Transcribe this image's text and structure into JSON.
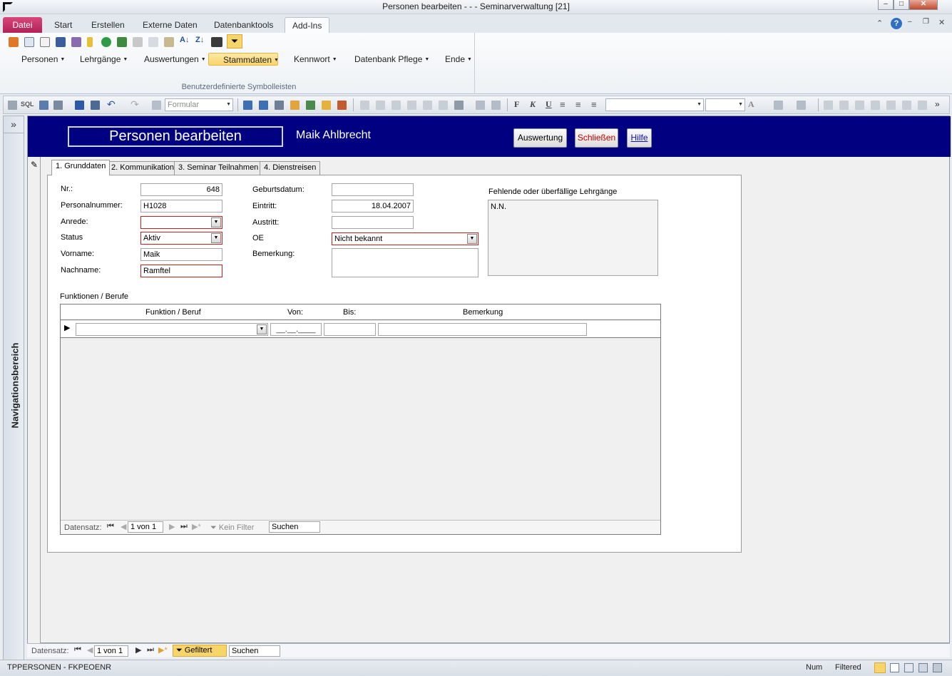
{
  "window": {
    "title": "Personen bearbeiten -  -  - Seminarverwaltung [21]"
  },
  "ribbon_tabs": [
    "Datei",
    "Start",
    "Erstellen",
    "Externe Daten",
    "Datenbanktools",
    "Add-Ins"
  ],
  "ribbon_menus": [
    "Personen",
    "Lehrgänge",
    "Auswertungen",
    "Stammdaten",
    "Kennwort",
    "Datenbank Pflege",
    "Ende"
  ],
  "ribbon_group_label": "Benutzerdefinierte Symbolleisten",
  "toolbar": {
    "sql_label": "SQL",
    "form_combo": "Formular",
    "bold": "F",
    "italic": "K",
    "underline": "U"
  },
  "nav_pane": {
    "label": "Navigationsbereich",
    "toggle": "»"
  },
  "form": {
    "title": "Personen bearbeiten",
    "person_name": "Maik Ahlbrecht",
    "buttons": {
      "auswertung": "Auswertung",
      "schliessen": "Schließen",
      "hilfe": "Hilfe"
    },
    "tabs": [
      "1. Grunddaten",
      "2. Kommunikation",
      "3. Seminar Teilnahmen",
      "4. Dienstreisen"
    ],
    "fields": {
      "nr": {
        "label": "Nr.:",
        "value": "648"
      },
      "personalnummer": {
        "label": "Personalnummer:",
        "value": "H1028"
      },
      "anrede": {
        "label": "Anrede:",
        "value": ""
      },
      "status": {
        "label": "Status",
        "value": "Aktiv"
      },
      "vorname": {
        "label": "Vorname:",
        "value": "Maik"
      },
      "nachname": {
        "label": "Nachname:",
        "value": "Ramftel"
      },
      "geburtsdatum": {
        "label": "Geburtsdatum:",
        "value": ""
      },
      "eintritt": {
        "label": "Eintritt:",
        "value": "18.04.2007"
      },
      "austritt": {
        "label": "Austritt:",
        "value": ""
      },
      "oe": {
        "label": "OE",
        "value": "Nicht bekannt"
      },
      "bemerkung": {
        "label": "Bemerkung:",
        "value": ""
      }
    },
    "missing_courses": {
      "label": "Fehlende oder überfällige Lehrgänge",
      "value": "N.N."
    },
    "subform": {
      "label": "Funktionen / Berufe",
      "columns": [
        "Funktion / Beruf",
        "Von:",
        "Bis:",
        "Bemerkung"
      ],
      "von_mask": "__.__.____",
      "nav": {
        "label": "Datensatz:",
        "position": "1 von 1",
        "filter": "Kein Filter",
        "search": "Suchen"
      }
    }
  },
  "main_nav": {
    "label": "Datensatz:",
    "position": "1 von 1",
    "filter": "Gefiltert",
    "search": "Suchen"
  },
  "statusbar": {
    "left": "TPPERSONEN - FKPEOENR",
    "num": "Num",
    "filtered": "Filtered"
  }
}
